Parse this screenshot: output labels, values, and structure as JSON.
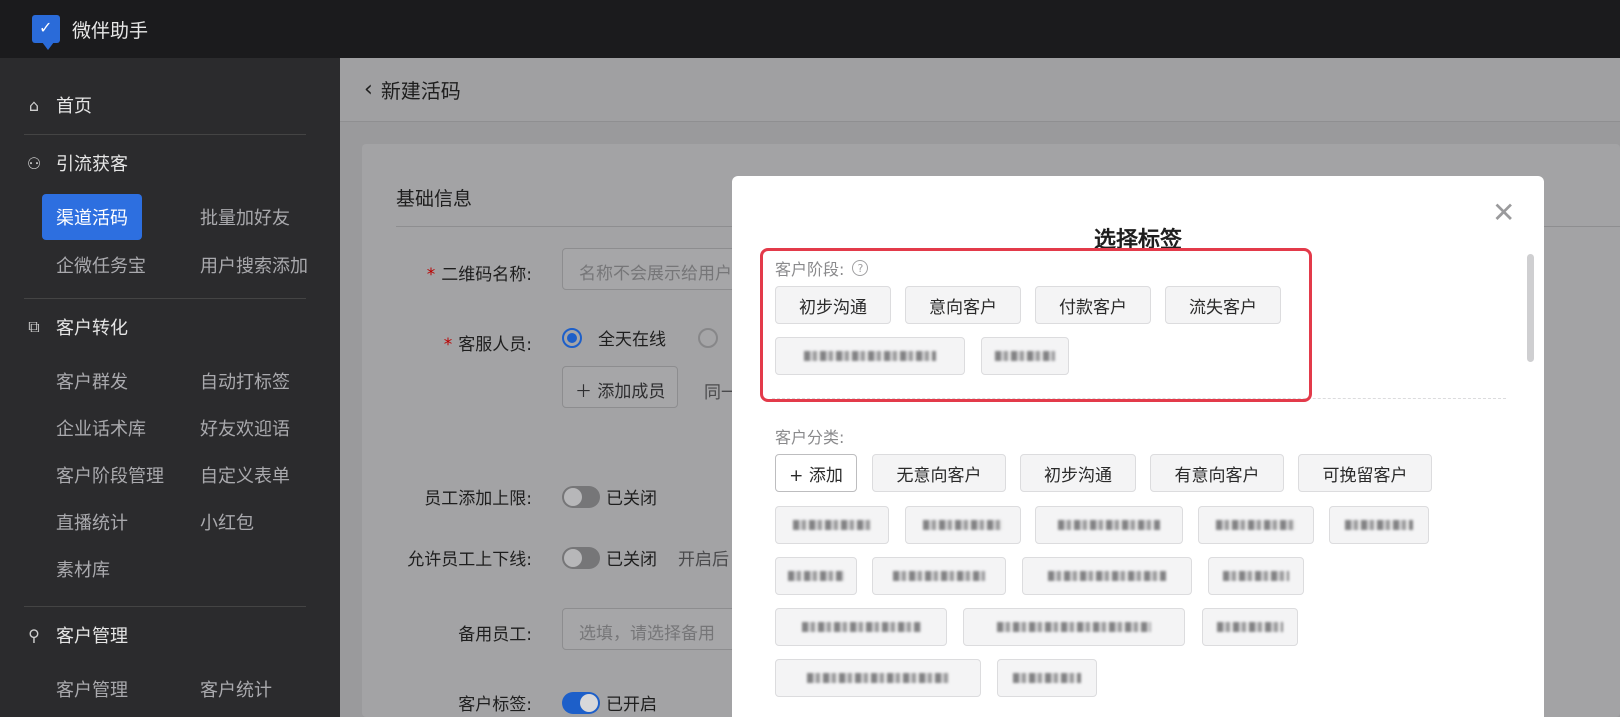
{
  "app": {
    "title": "微伴助手"
  },
  "sidebar": {
    "home": "首页",
    "sections": [
      {
        "title": "引流获客",
        "items": [
          "渠道活码",
          "批量加好友",
          "企微任务宝",
          "用户搜索添加"
        ]
      },
      {
        "title": "客户转化",
        "items": [
          "客户群发",
          "自动打标签",
          "企业话术库",
          "好友欢迎语",
          "客户阶段管理",
          "自定义表单",
          "直播统计",
          "小红包",
          "素材库"
        ]
      },
      {
        "title": "客户管理",
        "items": [
          "客户管理",
          "客户统计"
        ]
      }
    ],
    "active_item": "渠道活码"
  },
  "page": {
    "back_label": "新建活码",
    "section_title": "基础信息",
    "fields": {
      "qrcode_name_label": "二维码名称:",
      "qrcode_name_placeholder": "名称不会展示给用户",
      "staff_label": "客服人员:",
      "staff_option_all_day": "全天在线",
      "add_member": "添加成员",
      "add_member_hint": "同一",
      "staff_limit_label": "员工添加上限:",
      "staff_limit_state": "已关闭",
      "allow_online_label": "允许员工上下线:",
      "allow_online_state": "已关闭",
      "allow_online_hint": "开启后",
      "backup_staff_label": "备用员工:",
      "backup_staff_placeholder": "选填，请选择备用",
      "customer_tag_label": "客户标签:",
      "customer_tag_state": "已开启"
    }
  },
  "modal": {
    "title": "选择标签",
    "group_stage": {
      "label": "客户阶段:",
      "tags": [
        "初步沟通",
        "意向客户",
        "付款客户",
        "流失客户"
      ],
      "blurred_tags": 2
    },
    "group_category": {
      "label": "客户分类:",
      "add_label": "+ 添加",
      "tags": [
        "无意向客户",
        "初步沟通",
        "有意向客户",
        "可挽留客户"
      ],
      "blurred_tags": 15
    }
  },
  "colors": {
    "highlight": "#e33a4a",
    "accent": "#2d6fe0",
    "sidebar_bg": "#2b2b2d",
    "topbar_bg": "#1b1b1d"
  },
  "icons": [
    "app-logo-icon",
    "home-icon",
    "user-funnel-icon",
    "conversion-icon",
    "user-icon",
    "back-chevron-icon",
    "close-icon",
    "help-icon"
  ]
}
